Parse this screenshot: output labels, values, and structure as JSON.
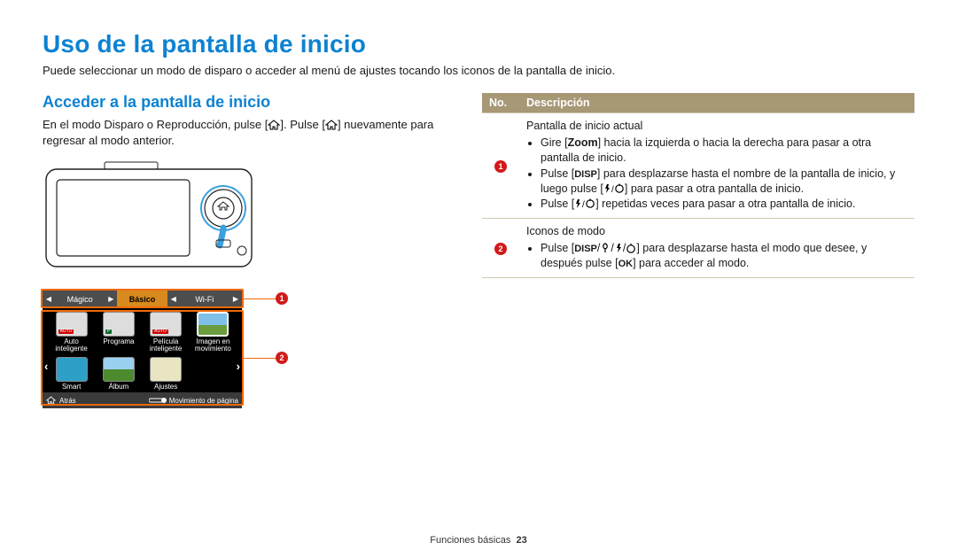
{
  "title": "Uso de la pantalla de inicio",
  "intro": "Puede seleccionar un modo de disparo o acceder al menú de ajustes tocando los iconos de la pantalla de inicio.",
  "section_heading": "Acceder a la pantalla de inicio",
  "section_body_a": "En el modo Disparo o Reproducción, pulse [",
  "section_body_b": "]. Pulse [",
  "section_body_c": "] nuevamente para regresar al modo anterior.",
  "panel": {
    "tab_left": "Mágico",
    "tab_center": "Básico",
    "tab_right": "Wi-Fi",
    "items": [
      {
        "line1": "Auto",
        "line2": "inteligente"
      },
      {
        "line1": "Programa",
        "line2": ""
      },
      {
        "line1": "Película",
        "line2": "inteligente"
      },
      {
        "line1": "Imagen en",
        "line2": "movimiento"
      },
      {
        "line1": "Smart",
        "line2": ""
      },
      {
        "line1": "Álbum",
        "line2": ""
      },
      {
        "line1": "Ajustes",
        "line2": ""
      }
    ],
    "back_label": "Atrás",
    "pager_label": "Movimiento de página"
  },
  "table": {
    "header_no": "No.",
    "header_desc": "Descripción",
    "row1_title": "Pantalla de inicio actual",
    "row1_b1a": "Gire [",
    "row1_b1_zoom": "Zoom",
    "row1_b1b": "] hacia la izquierda o hacia la derecha para pasar a otra pantalla de inicio.",
    "row1_b2a": "Pulse [",
    "row1_b2b": "] para desplazarse hasta el nombre de la pantalla de inicio, y luego pulse [",
    "row1_b2c": "] para pasar a otra pantalla de inicio.",
    "row1_b3a": "Pulse [",
    "row1_b3b": "] repetidas veces para pasar a otra pantalla de inicio.",
    "row2_title": "Iconos de modo",
    "row2_b1a": "Pulse [",
    "row2_b1b": "] para desplazarse hasta el modo que desee, y después pulse [",
    "row2_b1c": "] para acceder al modo.",
    "disp_label": "DISP",
    "ok_label": "OK"
  },
  "callouts": {
    "one": "1",
    "two": "2"
  },
  "footer_section": "Funciones básicas",
  "footer_page": "23"
}
